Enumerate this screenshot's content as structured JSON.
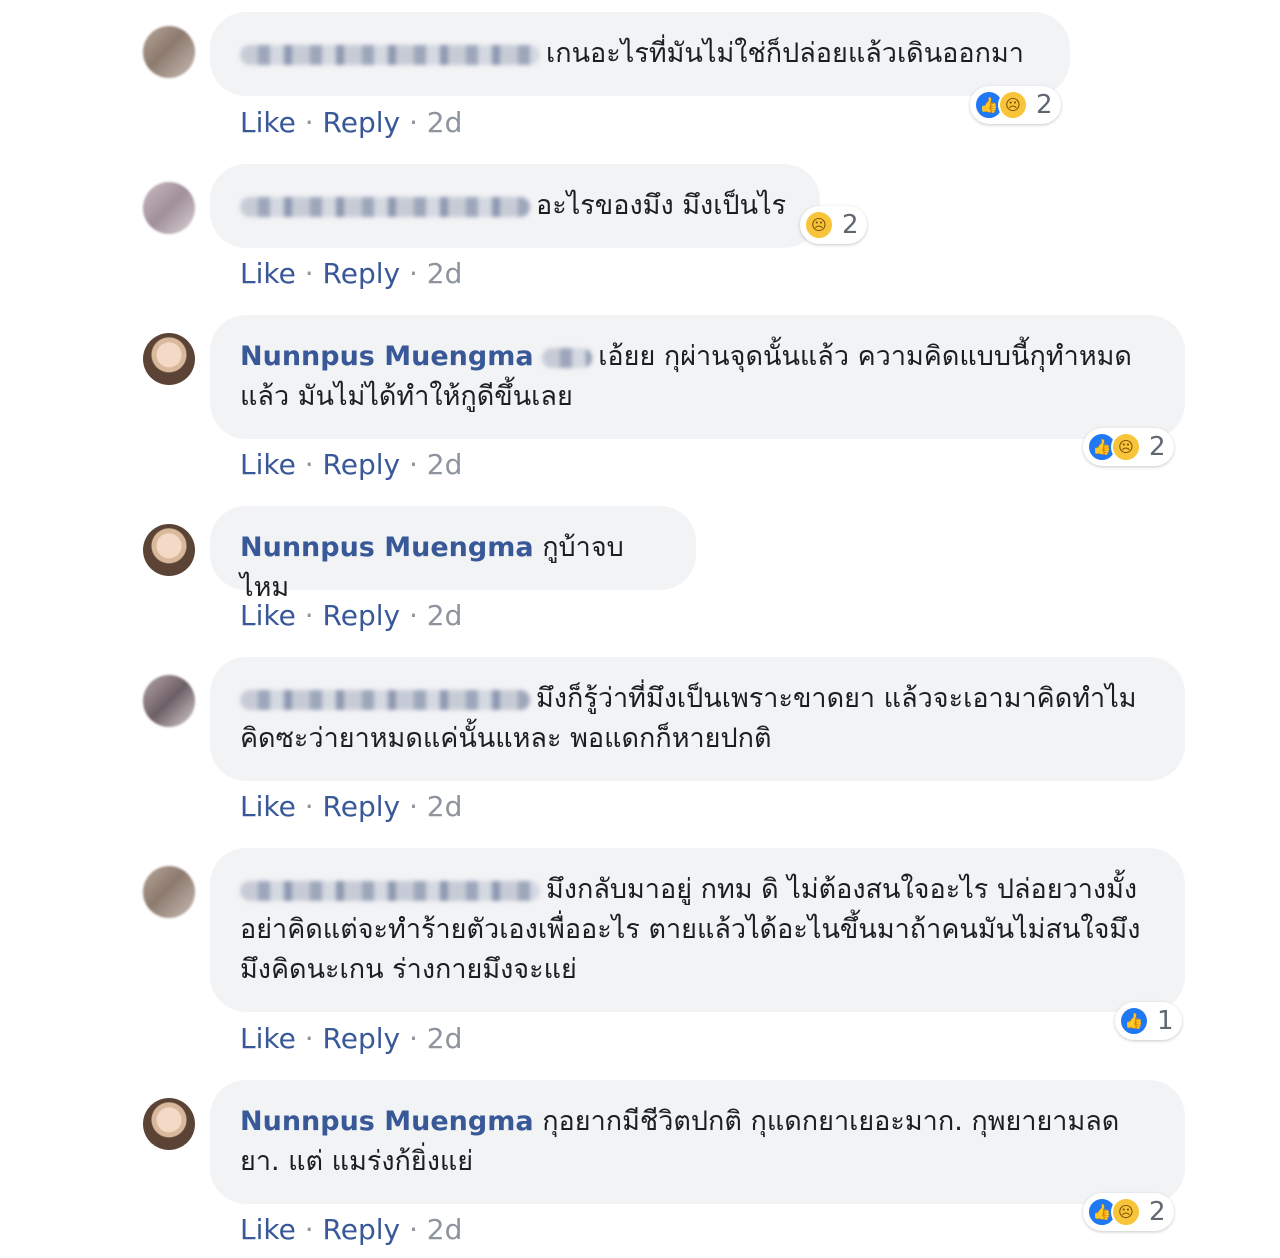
{
  "comments": [
    {
      "author": "",
      "text": "เกนอะไรที่มันไม่ใช่ก็ปล่อยแล้วเดินออกมา",
      "like": "Like",
      "reply": "Reply",
      "time": "2d",
      "reaction_count": "2"
    },
    {
      "author": "",
      "text": "อะไรของมึง มึงเป็นไร",
      "like": "Like",
      "reply": "Reply",
      "time": "2d",
      "reaction_count": "2"
    },
    {
      "author": "Nunnpus Muengma",
      "text": "เอ้ยย กุผ่านจุดนั้นแล้ว ความคิดแบบนี้กุทำหมดแล้ว มันไม่ได้ทำให้กูดีขึ้นเลย",
      "like": "Like",
      "reply": "Reply",
      "time": "2d",
      "reaction_count": "2"
    },
    {
      "author": "Nunnpus Muengma",
      "text": "กูบ้าจบไหม",
      "like": "Like",
      "reply": "Reply",
      "time": "2d",
      "reaction_count": ""
    },
    {
      "author": "",
      "text": "มึงก็รู้ว่าที่มึงเป็นเพราะขาดยา แล้วจะเอามาคิดทำไมคิดซะว่ายาหมดแค่นั้นแหละ พอแดกก็หายปกติ",
      "like": "Like",
      "reply": "Reply",
      "time": "2d",
      "reaction_count": ""
    },
    {
      "author": "",
      "text": "มึงกลับมาอยู่ กทม ดิ ไม่ต้องสนใจอะไร ปล่อยวางมั้ง อย่าคิดแต่จะทำร้ายตัวเองเพื่ออะไร ตายแล้วได้อะไนขึ้นมาถ้าคนมันไม่สนใจมึง มึงคิดนะเกน ร่างกายมึงจะแย่",
      "like": "Like",
      "reply": "Reply",
      "time": "2d",
      "reaction_count": "1"
    },
    {
      "author": "Nunnpus Muengma",
      "text": "กุอยากมีชีวิตปกติ กุแดกยาเยอะมาก. กุพยายามลดยา. แต่ แมร่งก้ยิ่งแย่",
      "like": "Like",
      "reply": "Reply",
      "time": "2d",
      "reaction_count": "2"
    }
  ],
  "separator": " · ",
  "icons": {
    "like_reaction": "thumbs-up-icon",
    "sad_reaction": "sad-face-icon"
  },
  "colors": {
    "name": "#385898",
    "bubble": "#f2f3f5",
    "meta": "#8d949e",
    "like_blue": "#2078f4"
  }
}
